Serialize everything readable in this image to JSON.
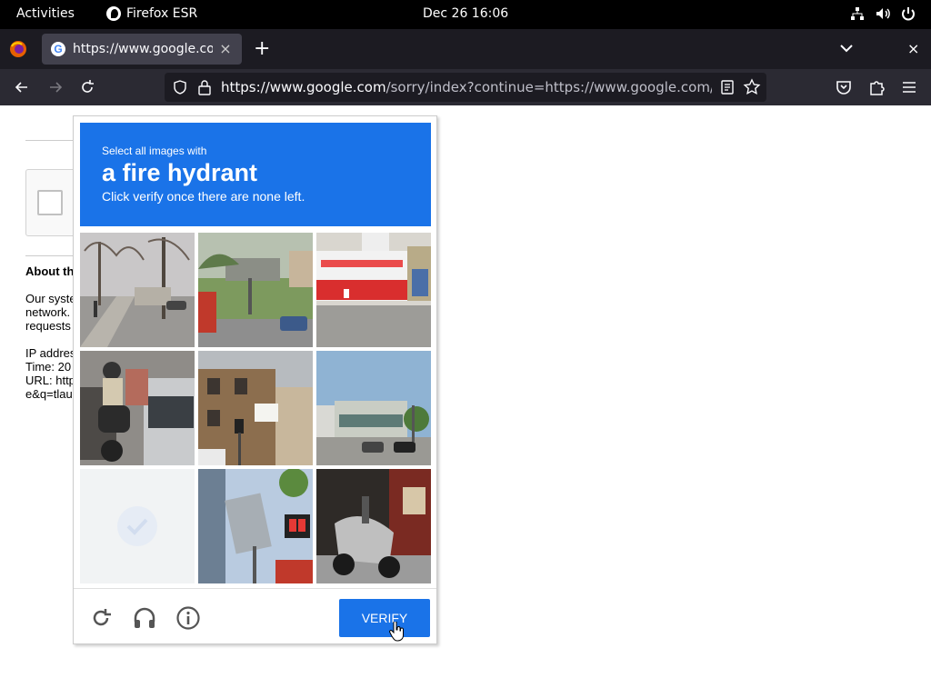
{
  "topbar": {
    "activities": "Activities",
    "app_name": "Firefox ESR",
    "clock": "Dec 26  16:06"
  },
  "browser": {
    "tab_title": "https://www.google.com/",
    "tab_close": "×",
    "new_tab": "+",
    "close_window": "×",
    "url_domain": "https://www.google.com",
    "url_path": "/sorry/index?continue=https://www.google.com/search"
  },
  "page": {
    "about_heading": "About th",
    "paragraph": "Our syste\nnetwork.\nrequests",
    "info": "IP addres\nTime: 20\nURL: http\ne&q=tlau"
  },
  "captcha": {
    "line1": "Select all images with",
    "target": "a fire hydrant",
    "line3": "Click verify once there are none left.",
    "verify_label": "VERIFY",
    "tiles": [
      "street-trees-tile",
      "billboard-road-tile",
      "red-white-building-tile",
      "motorcycle-car-tile",
      "brick-building-signal-tile",
      "office-building-tile",
      "faded-blank-tile",
      "pedestrian-signal-tile",
      "parked-scooter-tile"
    ]
  },
  "colors": {
    "captcha_blue": "#1a73e8",
    "topbar_bg": "#000000",
    "browser_dark": "#2b2a33"
  }
}
